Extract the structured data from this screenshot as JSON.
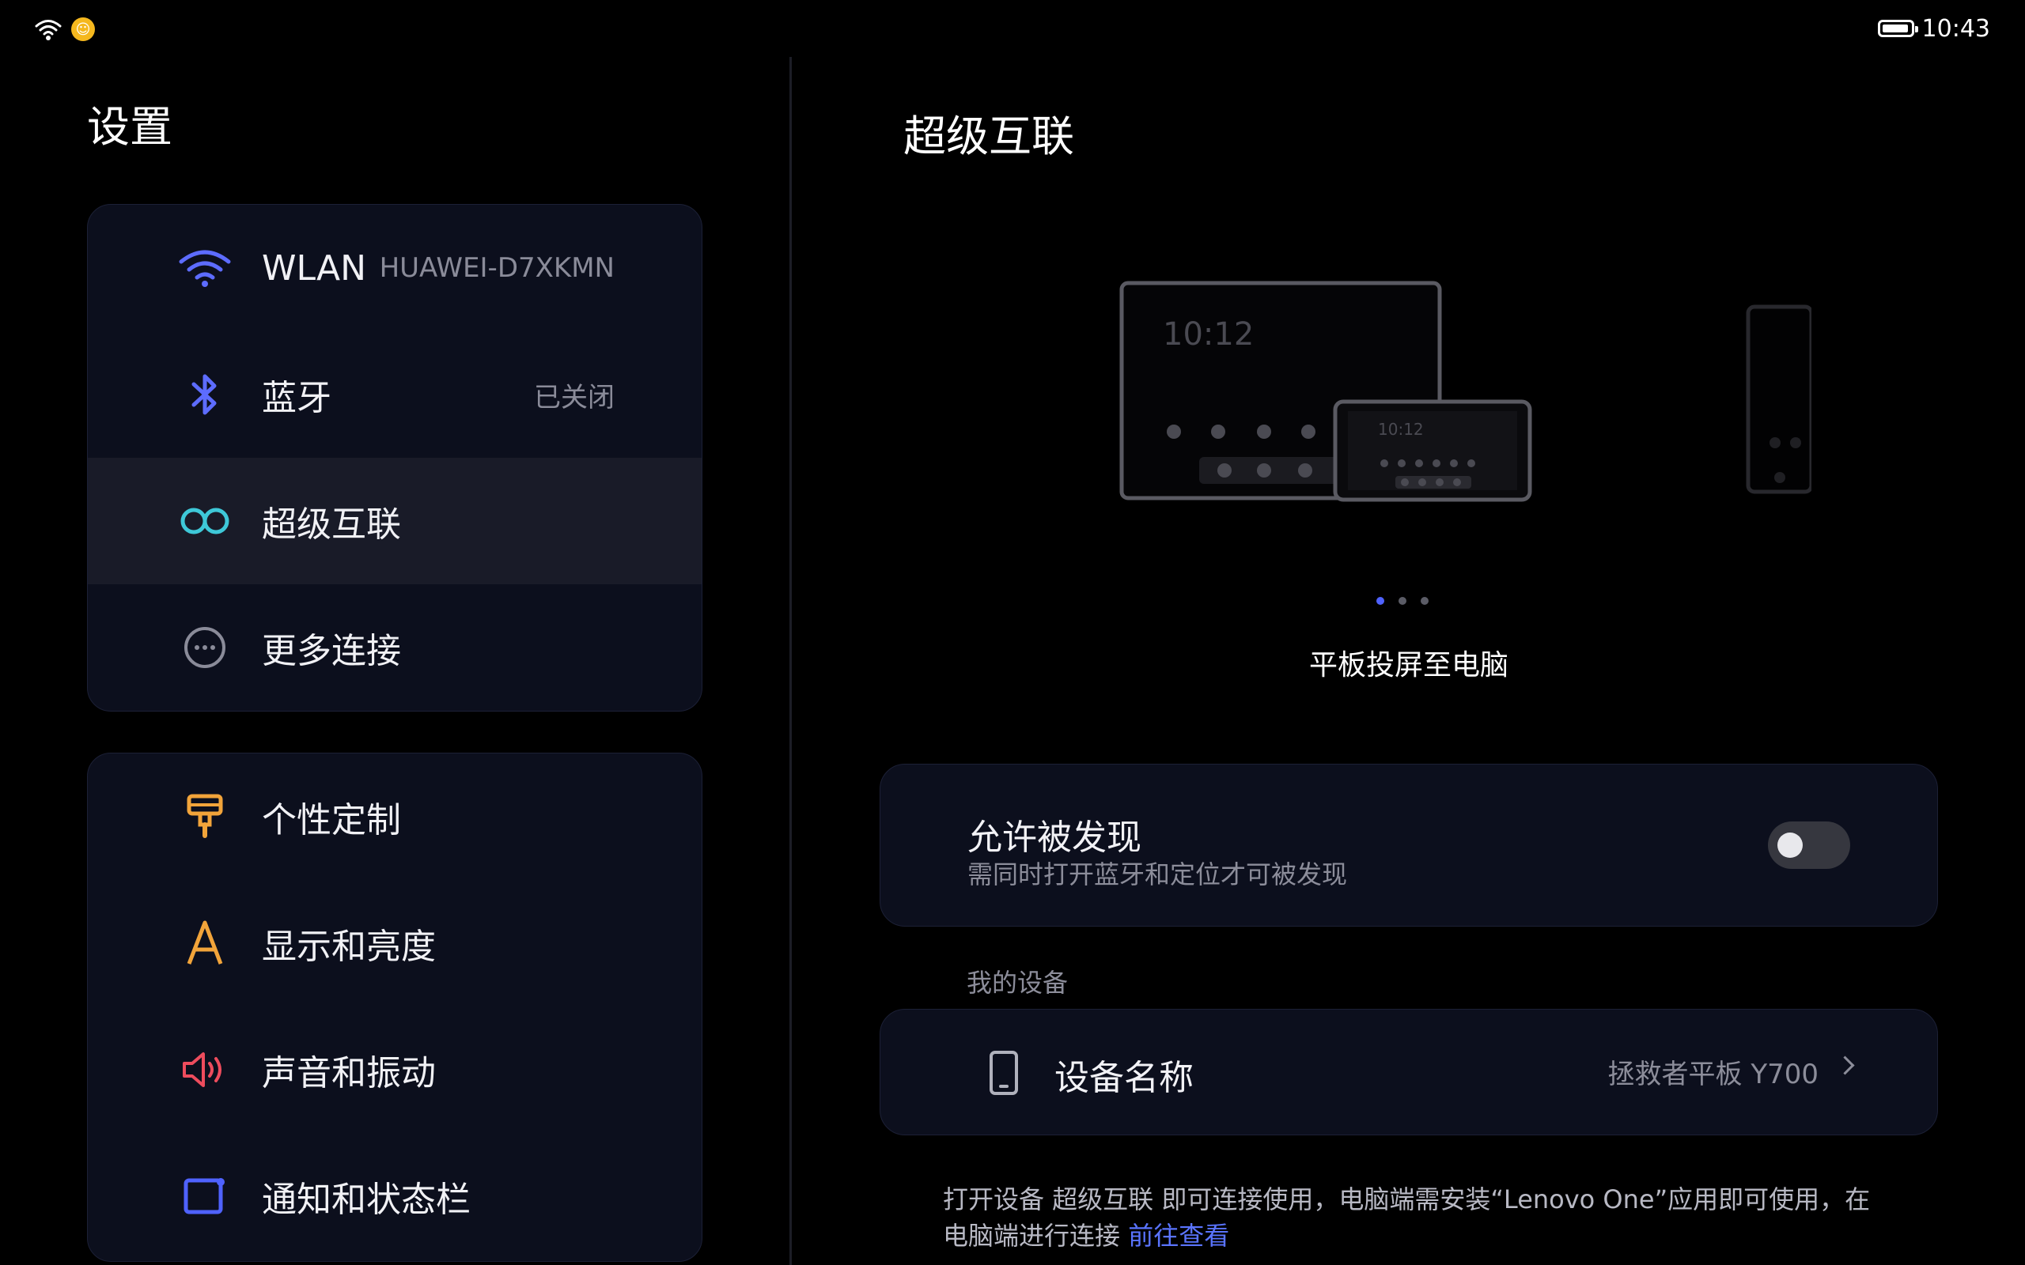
{
  "status_bar": {
    "time": "10:43",
    "battery_level": 0.95
  },
  "settings": {
    "title": "设置",
    "group1": [
      {
        "label": "WLAN",
        "value": "HUAWEI-D7XKMN",
        "icon": "wifi-icon"
      },
      {
        "label": "蓝牙",
        "value": "已关闭",
        "icon": "bluetooth-icon"
      },
      {
        "label": "超级互联",
        "value": "",
        "icon": "infinity-link-icon",
        "selected": true
      },
      {
        "label": "更多连接",
        "value": "",
        "icon": "more-circle-icon"
      }
    ],
    "group2": [
      {
        "label": "个性定制",
        "icon": "brush-icon"
      },
      {
        "label": "显示和亮度",
        "icon": "font-a-icon"
      },
      {
        "label": "声音和振动",
        "icon": "speaker-icon"
      },
      {
        "label": "通知和状态栏",
        "icon": "notification-panel-icon"
      }
    ]
  },
  "detail": {
    "title": "超级互联",
    "carousel": {
      "caption": "平板投屏至电脑",
      "tablet_time": "10:12",
      "phone_time": "10:12",
      "page_count": 3,
      "active_page": 1
    },
    "discover": {
      "title": "允许被发现",
      "subtitle": "需同时打开蓝牙和定位才可被发现",
      "enabled": false
    },
    "my_devices_label": "我的设备",
    "device": {
      "label": "设备名称",
      "value": "拯救者平板 Y700"
    },
    "note_prefix": "打开设备 超级互联 即可连接使用，电脑端需安装“Lenovo One”应用即可使用，在电脑端进行连接",
    "note_link": "前往查看"
  },
  "colors": {
    "accent": "#4f62ff",
    "wifi": "#5d6cff",
    "bluetooth": "#5d6cff",
    "link": "#3ec8d8",
    "personalize": "#f2a43a",
    "display": "#f2a43a",
    "sound": "#ee4c5d",
    "notification": "#4f62ff"
  }
}
